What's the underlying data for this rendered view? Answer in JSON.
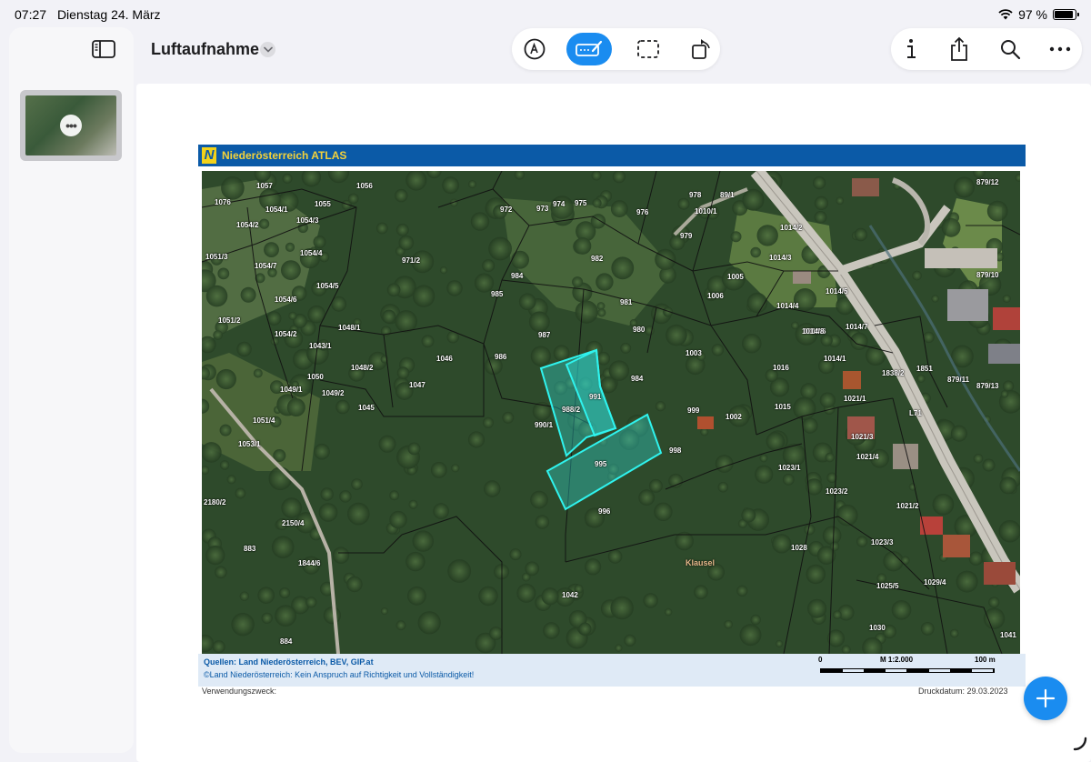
{
  "status_bar": {
    "time": "07:27",
    "date": "Dienstag 24. März",
    "battery_text": "97 %",
    "battery_level": 0.97
  },
  "document": {
    "title": "Luftaufnahme"
  },
  "toolbar": {
    "tools": [
      {
        "name": "pen-tool",
        "active": false
      },
      {
        "name": "annotate-tool",
        "active": true
      },
      {
        "name": "select-tool",
        "active": false
      },
      {
        "name": "rotate-tool",
        "active": false
      }
    ],
    "right_tools": [
      "info-icon",
      "share-icon",
      "search-icon",
      "more-icon"
    ],
    "accent_color": "#1a8cf0"
  },
  "map_doc": {
    "header_title": "Niederösterreich ATLAS",
    "logo_letter": "N",
    "source": "Quellen: Land Niederösterreich, BEV, GIP.at",
    "disclaimer": "©Land Niederösterreich: Kein Anspruch auf Richtigkeit und Vollständigkeit!",
    "scale": {
      "start": "0",
      "ratio": "M 1:2.000",
      "end": "100 m"
    },
    "purpose_label": "Verwendungszweck:",
    "print_date": "Druckdatum: 29.03.2023",
    "place_name": "Klausel",
    "road_label": "L71",
    "parcels": [
      "1057",
      "1076",
      "1054/1",
      "1055",
      "1056",
      "1054/3",
      "1054/2",
      "1054/4",
      "1051/3",
      "1054/7",
      "1054/5",
      "1054/6",
      "1051/2",
      "1054/2",
      "1048/1",
      "1043/1",
      "1048/2",
      "1046",
      "1050",
      "1049/1",
      "1049/2",
      "1047",
      "1045",
      "1051/4",
      "1053/1",
      "2180/2",
      "2150/4",
      "1844/6",
      "883",
      "884",
      "972",
      "973",
      "974",
      "975",
      "976",
      "978",
      "979",
      "1010/1",
      "89/1",
      "971/2",
      "982",
      "984",
      "985",
      "981",
      "987",
      "980",
      "986",
      "1005",
      "1006",
      "1003",
      "1014/2",
      "1014/3",
      "1014/4",
      "1014/5",
      "1014/6",
      "1014/7",
      "1014/1",
      "1014/8",
      "988/2",
      "991",
      "984",
      "990/1",
      "999",
      "998",
      "1002",
      "1015",
      "1016",
      "1021/1",
      "1021/3",
      "1021/4",
      "1021/2",
      "1023/1",
      "1023/2",
      "1023/3",
      "1025/5",
      "1029/4",
      "1030",
      "1042",
      "1028",
      "995",
      "996",
      "1041",
      "879/12",
      "879/10",
      "879/11",
      "879/13",
      "1851",
      "1838/2"
    ]
  }
}
